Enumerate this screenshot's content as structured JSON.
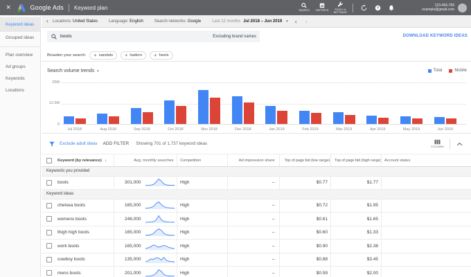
{
  "accent": {
    "blue": "#4285f4",
    "red": "#db4437",
    "link_blue": "#4181e8"
  },
  "topbar": {
    "close": "×",
    "brand": "Google Ads",
    "page_title": "Keyword plan",
    "icons": [
      {
        "name": "search",
        "label": "SEARCH"
      },
      {
        "name": "reports",
        "label": "REPORTS"
      },
      {
        "name": "tools",
        "label": "TOOLS &\nSETTINGS"
      }
    ],
    "account_id": "123-456-789",
    "account_email": "example@gmail.com"
  },
  "subbar": {
    "back": "‹",
    "items": [
      {
        "label": "Locations:",
        "value": "United States"
      },
      {
        "label": "Language:",
        "value": "English"
      },
      {
        "label": "Search networks:",
        "value": "Google"
      }
    ],
    "range_label": "Last 12 months",
    "range_value": "Jul 2018 – Jun 2019",
    "caret": "▾",
    "prev": "‹",
    "next": "›"
  },
  "sidebar": {
    "items": [
      {
        "label": "Keyword ideas",
        "active": true
      },
      {
        "label": "Grouped ideas",
        "active": false
      },
      {
        "divider": true
      },
      {
        "label": "Plan overview",
        "active": false
      },
      {
        "label": "Ad groups",
        "active": false
      },
      {
        "label": "Keywords",
        "active": false
      },
      {
        "label": "Locations",
        "active": false
      }
    ]
  },
  "search": {
    "query": "boots",
    "note": "Excluding brand names",
    "download_label": "DOWNLOAD KEYWORD IDEAS"
  },
  "broaden": {
    "label": "Broaden your search:",
    "chips": [
      "sandals",
      "loafers",
      "heels"
    ]
  },
  "chart_data": {
    "type": "bar",
    "title": "Search volume trends",
    "categories": [
      "Jul 2018",
      "Aug 2018",
      "Sep 2018",
      "Oct 2018",
      "Nov 2018",
      "Dec 2018",
      "Jan 2019",
      "Feb 2019",
      "Mar 2019",
      "Apr 2019",
      "May 2019",
      "Jun 2019"
    ],
    "series": [
      {
        "name": "Total",
        "color": "#4285f4",
        "values": [
          4.4,
          6.0,
          9.5,
          14.0,
          20.2,
          16.2,
          10.8,
          7.9,
          6.9,
          4.9,
          4.4,
          4.0
        ]
      },
      {
        "name": "Mobile",
        "color": "#db4437",
        "values": [
          3.1,
          4.6,
          7.1,
          10.6,
          15.5,
          12.8,
          7.9,
          6.5,
          5.5,
          3.8,
          3.2,
          3.2
        ]
      }
    ],
    "unit": "millions of searches",
    "ylim": [
      0,
      25
    ],
    "yticks": [
      {
        "label": "25M",
        "value": 25
      },
      {
        "label": "12.5M",
        "value": 12.5
      },
      {
        "label": "0",
        "value": 0
      }
    ],
    "legend_position": "top-right",
    "grid": "dashed horizontal"
  },
  "filterbar": {
    "exclude_link": "Exclude adult ideas",
    "add_filter": "ADD FILTER",
    "showing": "Showing 701 of 1,737 keyword ideas",
    "columns_label": "COLUMNS"
  },
  "table": {
    "columns": [
      "Keyword (by relevance)",
      "Avg. monthly searches",
      "Competition",
      "Ad impression share",
      "Top of page bid (low range)",
      "Top of page bid (high range)",
      "Account status"
    ],
    "sort_arrow": "↓",
    "sections": [
      {
        "title": "Keywords you provided",
        "rows": [
          {
            "keyword": "boots",
            "avg_monthly_searches": "301,000",
            "competition": "High",
            "ad_impression_share": "–",
            "bid_low": "$0.77",
            "bid_high": "$1.77",
            "account_status": "",
            "spark": [
              0.08,
              0.09,
              0.12,
              0.22,
              0.55,
              1.0,
              0.72,
              0.28,
              0.14,
              0.1,
              0.09,
              0.1
            ]
          }
        ]
      },
      {
        "title": "Keyword ideas",
        "rows": [
          {
            "keyword": "chelsea boots",
            "avg_monthly_searches": "165,000",
            "competition": "High",
            "ad_impression_share": "–",
            "bid_low": "$0.72",
            "bid_high": "$1.95",
            "account_status": "",
            "spark": [
              0.1,
              0.12,
              0.18,
              0.35,
              0.75,
              1.0,
              0.62,
              0.3,
              0.18,
              0.14,
              0.12,
              0.11
            ]
          },
          {
            "keyword": "womens boots",
            "avg_monthly_searches": "246,000",
            "competition": "High",
            "ad_impression_share": "–",
            "bid_low": "$0.61",
            "bid_high": "$1.65",
            "account_status": "",
            "spark": [
              0.06,
              0.07,
              0.09,
              0.14,
              0.38,
              1.0,
              0.42,
              0.18,
              0.1,
              0.08,
              0.07,
              0.07
            ]
          },
          {
            "keyword": "thigh high boots",
            "avg_monthly_searches": "165,000",
            "competition": "High",
            "ad_impression_share": "–",
            "bid_low": "$0.60",
            "bid_high": "$1.33",
            "account_status": "",
            "spark": [
              0.08,
              0.1,
              0.16,
              0.34,
              0.72,
              1.0,
              0.8,
              0.35,
              0.16,
              0.1,
              0.08,
              0.08
            ]
          },
          {
            "keyword": "work boots",
            "avg_monthly_searches": "165,000",
            "competition": "High",
            "ad_impression_share": "–",
            "bid_low": "$0.90",
            "bid_high": "$2.38",
            "account_status": "",
            "spark": [
              0.18,
              0.26,
              0.42,
              0.68,
              0.55,
              0.34,
              0.48,
              0.62,
              0.5,
              0.3,
              0.22,
              0.18
            ]
          },
          {
            "keyword": "cowboy boots",
            "avg_monthly_searches": "135,000",
            "competition": "High",
            "ad_impression_share": "–",
            "bid_low": "$0.88",
            "bid_high": "$3.45",
            "account_status": "",
            "spark": [
              0.15,
              0.3,
              0.55,
              0.5,
              0.72,
              0.68,
              0.4,
              0.78,
              0.35,
              0.22,
              0.18,
              0.15
            ]
          },
          {
            "keyword": "mens boots",
            "avg_monthly_searches": "201,000",
            "competition": "High",
            "ad_impression_share": "–",
            "bid_low": "$0.59",
            "bid_high": "$2.00",
            "account_status": "",
            "spark": [
              0.07,
              0.08,
              0.11,
              0.2,
              0.48,
              1.0,
              0.78,
              0.3,
              0.14,
              0.1,
              0.08,
              0.08
            ]
          }
        ]
      }
    ]
  }
}
